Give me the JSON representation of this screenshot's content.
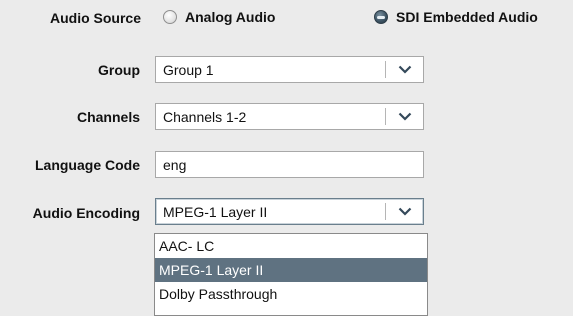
{
  "audio_source": {
    "label": "Audio Source",
    "options": [
      {
        "label": "Analog Audio",
        "selected": false
      },
      {
        "label": "SDI Embedded Audio",
        "selected": true
      }
    ]
  },
  "group": {
    "label": "Group",
    "value": "Group 1"
  },
  "channels": {
    "label": "Channels",
    "value": "Channels 1-2"
  },
  "language_code": {
    "label": "Language Code",
    "value": "eng"
  },
  "audio_encoding": {
    "label": "Audio Encoding",
    "value": "MPEG-1 Layer II",
    "options": [
      "AAC- LC",
      "MPEG-1 Layer II",
      "Dolby Passthrough"
    ],
    "highlighted_option": "MPEG-1 Layer II"
  },
  "colors": {
    "background": "#ebebeb",
    "selection": "#5f7281",
    "radio_selected": "#3f5666"
  },
  "icons": {
    "dropdown_arrow": "chevron-down-icon"
  }
}
